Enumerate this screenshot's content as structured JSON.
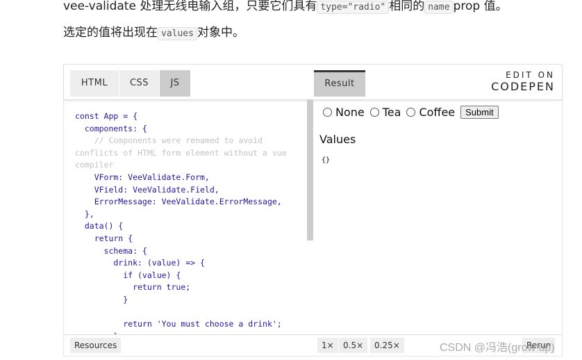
{
  "paragraph": {
    "line1_a": "vee-validate 处理无线电输入组，只要它们具有",
    "code1": "type=\"radio\"",
    "line1_b": "相同的",
    "code2": "name",
    "line1_c": "prop 值。",
    "line2_a": "选定的值将出现在",
    "code3": "values",
    "line2_b": "对象中。"
  },
  "tabs": {
    "html": "HTML",
    "css": "CSS",
    "js": "JS",
    "result": "Result",
    "active_editor": "JS"
  },
  "codepen": {
    "edit_on": "EDIT ON",
    "brand": "CODEPEN"
  },
  "code": [
    "const App = {",
    "  components: {",
    "    // Components were renamed to avoid",
    "conflicts of HTML form element without a vue",
    "compiler",
    "    VForm: VeeValidate.Form,",
    "    VField: VeeValidate.Field,",
    "    ErrorMessage: VeeValidate.ErrorMessage,",
    "  },",
    "  data() {",
    "    return {",
    "      schema: {",
    "        drink: (value) => {",
    "          if (value) {",
    "            return true;",
    "          }",
    "",
    "          return 'You must choose a drink';",
    "        }"
  ],
  "result": {
    "options": [
      "None",
      "Tea",
      "Coffee"
    ],
    "submit": "Submit",
    "values_heading": "Values",
    "values": "{}"
  },
  "footer": {
    "resources": "Resources",
    "zoom": [
      "1×",
      "0.5×",
      "0.25×"
    ],
    "rerun": "Rerun"
  },
  "watermark": "CSDN @冯浩(grow up)"
}
